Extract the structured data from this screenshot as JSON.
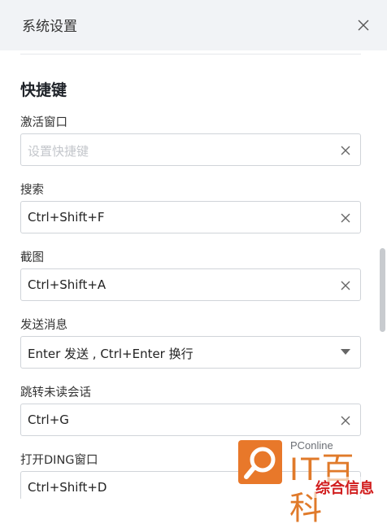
{
  "header": {
    "title": "系统设置"
  },
  "section": {
    "title": "快捷键"
  },
  "fields": [
    {
      "label": "激活窗口",
      "value": "",
      "placeholder": "设置快捷键"
    },
    {
      "label": "搜索",
      "value": "Ctrl+Shift+F"
    },
    {
      "label": "截图",
      "value": "Ctrl+Shift+A"
    },
    {
      "label": "发送消息",
      "value": "Enter 发送 , Ctrl+Enter 换行"
    },
    {
      "label": "跳转未读会话",
      "value": "Ctrl+G"
    },
    {
      "label": "打开DING窗口",
      "value": "Ctrl+Shift+D"
    }
  ],
  "watermark": {
    "brand": "PConline",
    "big": "IT百科",
    "tag": "综合信息"
  },
  "icons": {
    "close": "close-icon",
    "clear": "clear-x-icon",
    "dropdown": "caret-down-icon",
    "logo": "magnifier-logo"
  },
  "colors": {
    "header_bg": "#f1f3f6",
    "border": "#d0d4d9",
    "watermark_orange": "#e07a2a",
    "watermark_red": "#d11d1d"
  }
}
